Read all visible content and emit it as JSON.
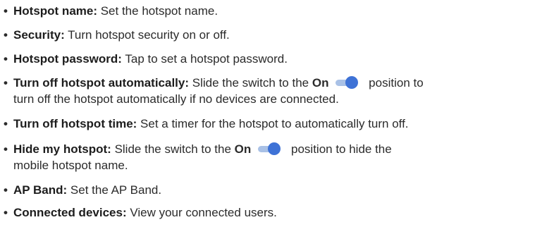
{
  "bullet": "•",
  "items": [
    {
      "term": "Hotspot name:",
      "desc": " Set the hotspot name."
    },
    {
      "term": "Security:",
      "desc": " Turn hotspot security on or off."
    },
    {
      "term": "Hotspot password:",
      "desc": " Tap to set a hotspot password."
    },
    {
      "term": "Turn off hotspot automatically:",
      "desc_before": " Slide the switch to the ",
      "on_word": "On",
      "desc_after": " position to",
      "desc_line2": "turn off the hotspot automatically if no devices are connected."
    },
    {
      "term": "Turn off hotspot time:",
      "desc": " Set a timer for the hotspot to automatically turn off."
    },
    {
      "term": "Hide my hotspot:",
      "desc_before": " Slide the switch to the ",
      "on_word": "On",
      "desc_after": " position to hide the",
      "desc_line2": "mobile hotspot name."
    },
    {
      "term": "AP Band:",
      "desc": " Set the AP Band."
    },
    {
      "term": "Connected devices:",
      "desc": " View your connected users."
    }
  ],
  "toggle_icon": "toggle-on-icon",
  "colors": {
    "toggle_knob": "#3e72d6",
    "toggle_track": "#a9c1e6",
    "text": "#2b2b2b"
  }
}
